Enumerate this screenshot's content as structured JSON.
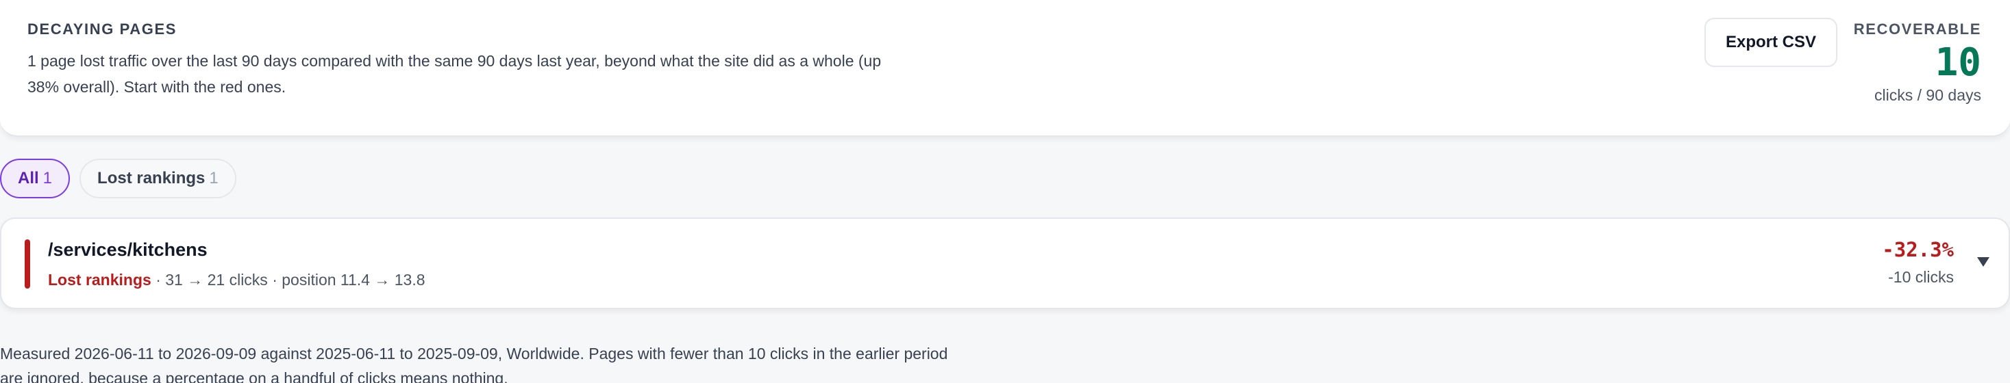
{
  "summary": {
    "eyebrow": "DECAYING PAGES",
    "description": "1 page lost traffic over the last 90 days compared with the same 90 days last year, beyond what the site did as a whole (up 38% overall). Start with the red ones.",
    "export_label": "Export CSV",
    "recoverable_label": "RECOVERABLE",
    "recoverable_value": "10",
    "recoverable_unit": "clicks / 90 days"
  },
  "filters": [
    {
      "label": "All",
      "count": "1",
      "active": true
    },
    {
      "label": "Lost rankings",
      "count": "1",
      "active": false
    }
  ],
  "rows": [
    {
      "path": "/services/kitchens",
      "reason": "Lost rankings",
      "details": " · 31 → 21 clicks · position 11.4 → 13.8",
      "change_pct": "-32.3%",
      "change_clicks": "-10 clicks",
      "severity_color": "#b91c1c"
    }
  ],
  "footnote": "Measured 2026-06-11 to 2026-09-09 against 2025-06-11 to 2025-09-09, Worldwide. Pages with fewer than 10 clicks in the earlier period are ignored, because a percentage on a handful of clicks means nothing.",
  "colors": {
    "accent": "#7c3aed",
    "positive": "#047857",
    "negative": "#b91c1c"
  },
  "icons": {
    "expand": "chevron-down-icon"
  }
}
